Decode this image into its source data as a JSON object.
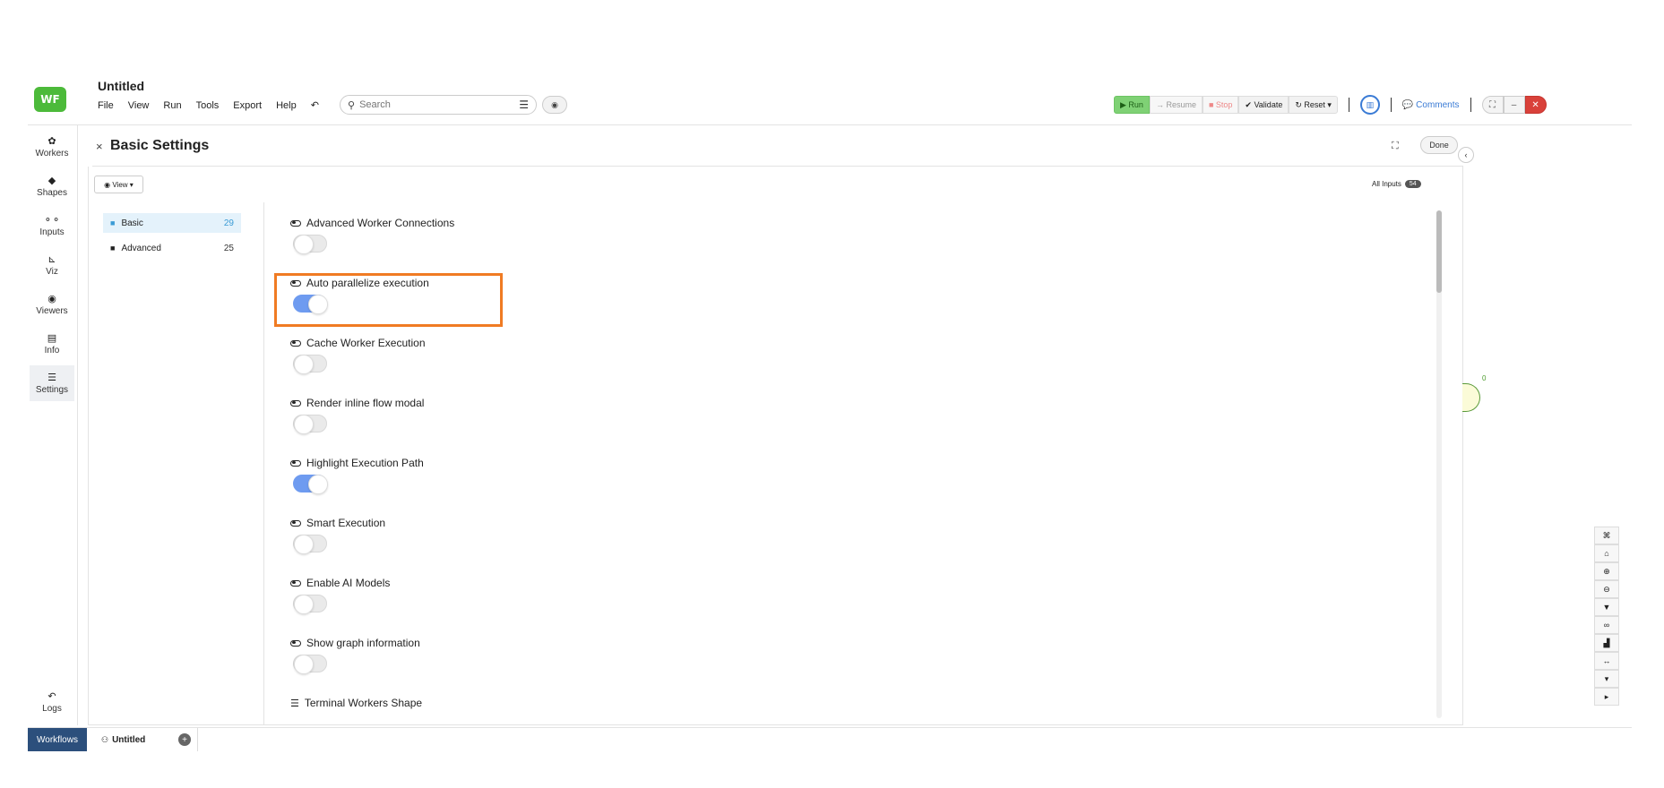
{
  "app": {
    "logo_text": "WF",
    "title": "Untitled"
  },
  "menu": [
    "File",
    "View",
    "Run",
    "Tools",
    "Export",
    "Help"
  ],
  "search": {
    "placeholder": "Search"
  },
  "toolbar": {
    "run": "Run",
    "resume": "Resume",
    "stop": "Stop",
    "validate": "Validate",
    "reset": "Reset",
    "comments": "Comments"
  },
  "sidebar": {
    "items": [
      {
        "label": "Workers",
        "icon": "gear-icon"
      },
      {
        "label": "Shapes",
        "icon": "diamond-icon"
      },
      {
        "label": "Inputs",
        "icon": "inputs-icon"
      },
      {
        "label": "Viz",
        "icon": "chart-icon"
      },
      {
        "label": "Viewers",
        "icon": "eye-icon"
      },
      {
        "label": "Info",
        "icon": "document-icon"
      },
      {
        "label": "Settings",
        "icon": "sliders-icon"
      }
    ],
    "logs": "Logs"
  },
  "panel": {
    "title": "Basic Settings",
    "done": "Done",
    "view": "View",
    "all_inputs": "All Inputs",
    "all_inputs_count": "54"
  },
  "categories": [
    {
      "label": "Basic",
      "count": "29"
    },
    {
      "label": "Advanced",
      "count": "25"
    }
  ],
  "settings": [
    {
      "label": "Advanced Worker Connections",
      "on": false
    },
    {
      "label": "Auto parallelize execution",
      "on": true
    },
    {
      "label": "Cache Worker Execution",
      "on": false
    },
    {
      "label": "Render inline flow modal",
      "on": false
    },
    {
      "label": "Highlight Execution Path",
      "on": true
    },
    {
      "label": "Smart Execution",
      "on": false
    },
    {
      "label": "Enable AI Models",
      "on": false
    },
    {
      "label": "Show graph information",
      "on": false
    },
    {
      "label": "Terminal Workers Shape"
    }
  ],
  "canvas": {
    "node_label": "0"
  },
  "bottom": {
    "workflows": "Workflows",
    "tab": "Untitled"
  },
  "colors": {
    "accent": "#3a7bd5",
    "toggle_on": "#6e9bf0",
    "highlight": "#f07b23",
    "run": "#7fd175"
  }
}
